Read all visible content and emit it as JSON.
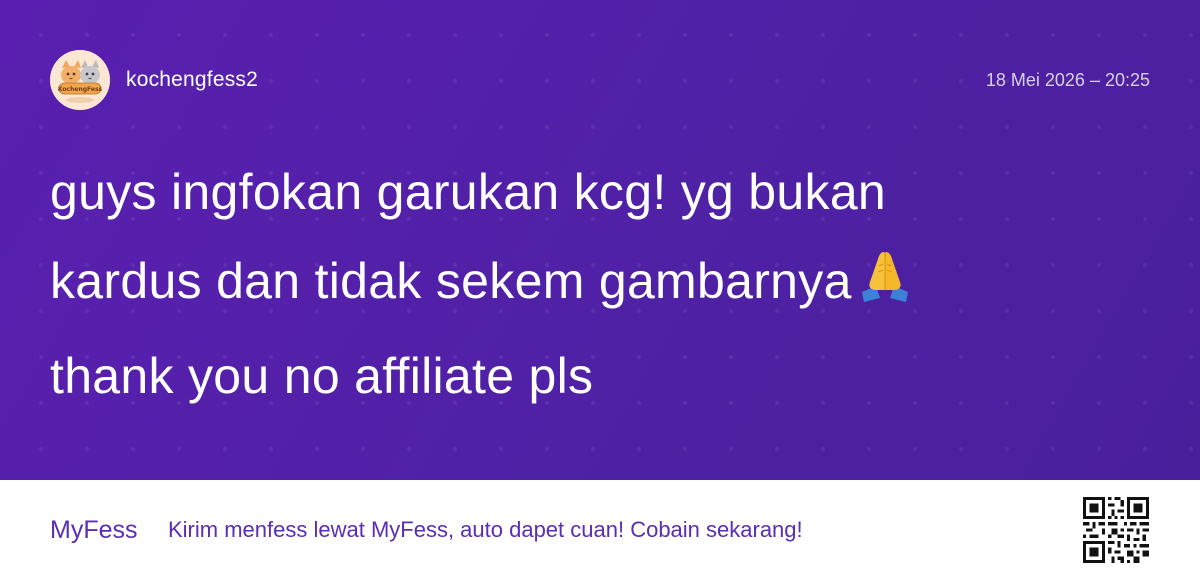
{
  "post": {
    "username": "kochengfess2",
    "timestamp": "18 Mei 2026 – 20:25",
    "message_lines": [
      "guys ingfokan garukan kcg! yg bukan",
      "kardus dan tidak sekem gambarnya",
      "thank you no affiliate pls"
    ],
    "emoji": "folded-hands"
  },
  "avatar": {
    "badge_text": "KochengFess"
  },
  "footer": {
    "brand": "MyFess",
    "promo": "Kirim menfess lewat MyFess, auto dapet cuan! Cobain sekarang!"
  },
  "colors": {
    "background": "#521fa6",
    "accent": "#5a2db5",
    "footer_bg": "#ffffff",
    "text": "#ffffff"
  }
}
